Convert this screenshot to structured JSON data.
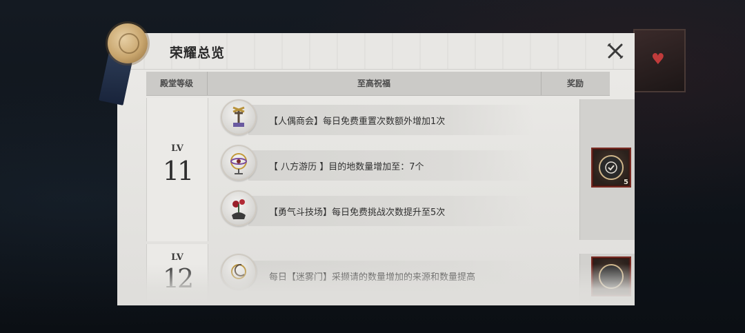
{
  "panel": {
    "title": "荣耀总览"
  },
  "table": {
    "headers": {
      "level": "殿堂等级",
      "blessing": "至高祝福",
      "reward": "奖励"
    }
  },
  "rows": [
    {
      "level_prefix": "LV",
      "level_number": "11",
      "blessings": [
        {
          "text": "【人偶商会】每日免费重置次数额外增加1次",
          "icon": "puppet-guild-icon"
        },
        {
          "text": "【 八方游历 】目的地数量增加至：7个",
          "icon": "armillary-sphere-icon"
        },
        {
          "text": "【勇气斗技场】每日免费挑战次数提升至5次",
          "icon": "rose-skull-icon"
        }
      ],
      "reward": {
        "icon": "badge-icon",
        "count": "5"
      }
    },
    {
      "level_prefix": "LV",
      "level_number": "12",
      "blessings": [
        {
          "text": "每日【迷雾门】采撷请的数量增加的来源和数量提高",
          "icon": "moon-orb-icon"
        }
      ],
      "reward": {
        "icon": "badge-icon",
        "count": ""
      }
    }
  ],
  "colors": {
    "panel_bg": "#e4e3e0",
    "reward_border": "#7a2a22",
    "seal_gold": "#c8a56d"
  }
}
